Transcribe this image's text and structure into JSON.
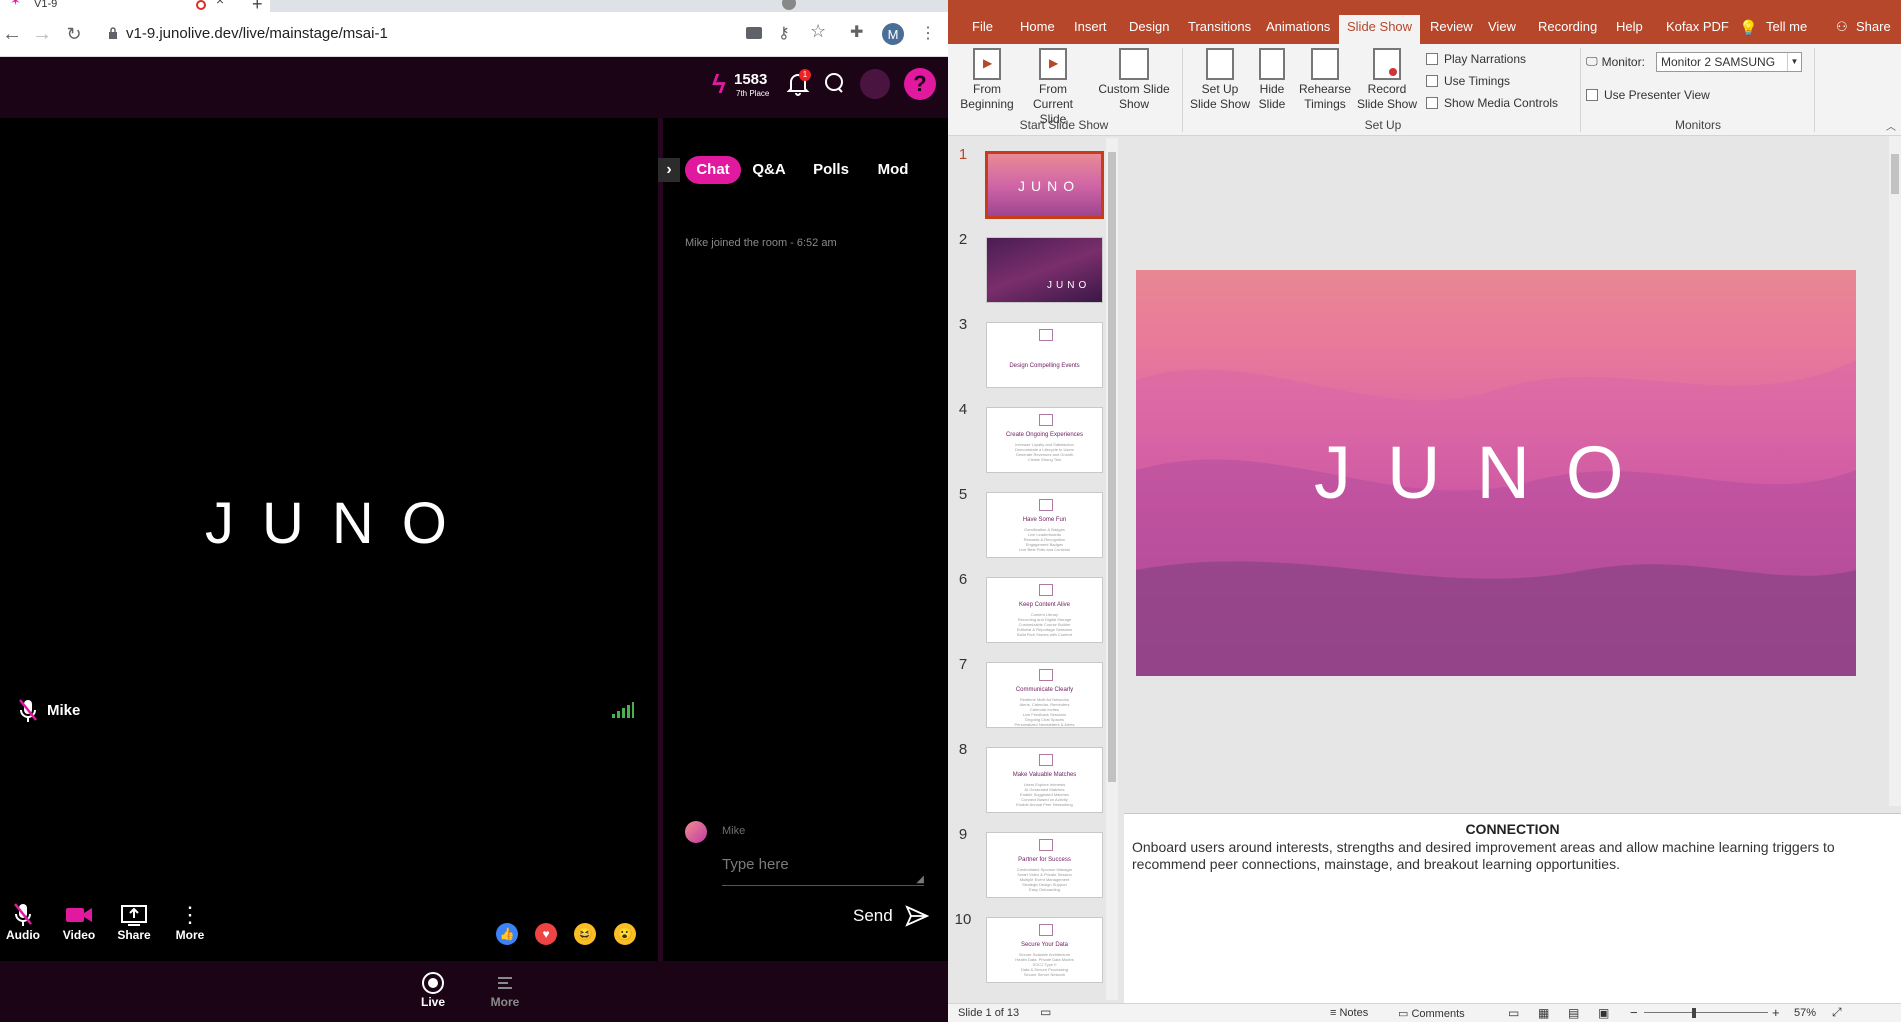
{
  "browser": {
    "tab_title": "V1-9",
    "new_tab_label": "+",
    "url": "v1-9.junolive.dev/live/mainstage/msai-1",
    "profile_initial": "M"
  },
  "juno": {
    "points": "1583",
    "place": "7th Place",
    "notification_count": "1",
    "help_glyph": "?",
    "logo_text": "JUNO",
    "presenter_name": "Mike",
    "chat_tabs": [
      "Chat",
      "Q&A",
      "Polls",
      "Mod"
    ],
    "system_message": "Mike joined the room - 6:52 am",
    "input_user": "Mike",
    "input_placeholder": "Type here",
    "send_label": "Send",
    "controls": [
      "Audio",
      "Video",
      "Share",
      "More"
    ],
    "bottom_nav": [
      "Live",
      "More"
    ],
    "colors": {
      "accent": "#e0199f",
      "header_bg": "#1a0416"
    }
  },
  "ppt": {
    "menu": [
      "File",
      "Home",
      "Insert",
      "Design",
      "Transitions",
      "Animations",
      "Slide Show",
      "Review",
      "View",
      "Recording",
      "Help",
      "Kofax PDF",
      "Tell me",
      "Share"
    ],
    "active_tab": "Slide Show",
    "ribbon": {
      "from_beginning": "From Beginning",
      "from_current": "From Current Slide",
      "custom_show": "Custom Slide Show",
      "group_start": "Start Slide Show",
      "set_up": "Set Up Slide Show",
      "hide_slide": "Hide Slide",
      "rehearse": "Rehearse Timings",
      "record": "Record Slide Show",
      "play_narrations": "Play Narrations",
      "use_timings": "Use Timings",
      "show_media": "Show Media Controls",
      "group_setup": "Set Up",
      "monitor_label": "Monitor:",
      "monitor_value": "Monitor 2 SAMSUNG",
      "presenter_view": "Use Presenter View",
      "group_monitors": "Monitors"
    },
    "slides": [
      {
        "num": "1",
        "title": "JUNO",
        "lines": []
      },
      {
        "num": "2",
        "title": "JUNO",
        "lines": []
      },
      {
        "num": "3",
        "title": "Design Compelling Events",
        "lines": []
      },
      {
        "num": "4",
        "title": "Create Ongoing Experiences",
        "lines": [
          "Increase Loyalty and Satisfaction",
          "Demonstrate a Lifecycle to Users",
          "Generate Revenues and Growth",
          "Create Strong Ties"
        ]
      },
      {
        "num": "5",
        "title": "Have Some Fun",
        "lines": [
          "Gamification & Badges",
          "Live Leaderboards",
          "Rewards & Recognition",
          "Engagement Badges",
          "Live Best Polls and Contests"
        ]
      },
      {
        "num": "6",
        "title": "Keep Content Alive",
        "lines": [
          "Content Library",
          "Recording and Digital Storage",
          "Customizable Course Builder",
          "Editorial & Reportage Sessions",
          "Build Rich Stories with Content"
        ]
      },
      {
        "num": "7",
        "title": "Communicate Clearly",
        "lines": [
          "Realtime Multi Ad Networks",
          "Alerts, Calendar, Reminders",
          "Calendar Invites",
          "Live Feedback Sessions",
          "Ongoing Chat Spaces",
          "Personalized Newsletters & Alerts"
        ]
      },
      {
        "num": "8",
        "title": "Make Valuable Matches",
        "lines": [
          "Users Explore Interests",
          "AI Generated Matches",
          "Enable Suggested Matches",
          "Connect Based on Activity",
          "Enable Annual Peer Networking"
        ]
      },
      {
        "num": "9",
        "title": "Partner for Success",
        "lines": [
          "Credentialed Sponsor Manager",
          "Smart Video & Private Session",
          "Multiple Event Management",
          "Strategic Design Support",
          "Easy Onboarding"
        ]
      },
      {
        "num": "10",
        "title": "Secure Your Data",
        "lines": [
          "Secure Scalable Architecture",
          "Health Data, Private Data Modes",
          "SOC2 Type II",
          "Data & Secure Processing",
          "Secure Server Network"
        ]
      }
    ],
    "main_slide_text": "JUNO",
    "notes_title": "CONNECTION",
    "notes_body": "Onboard users around interests, strengths and desired improvement areas and allow machine learning triggers to recommend peer connections, mainstage, and breakout learning opportunities.",
    "status_slide": "Slide 1 of 13",
    "notes_btn": "Notes",
    "comments_btn": "Comments",
    "zoom": "57%"
  }
}
